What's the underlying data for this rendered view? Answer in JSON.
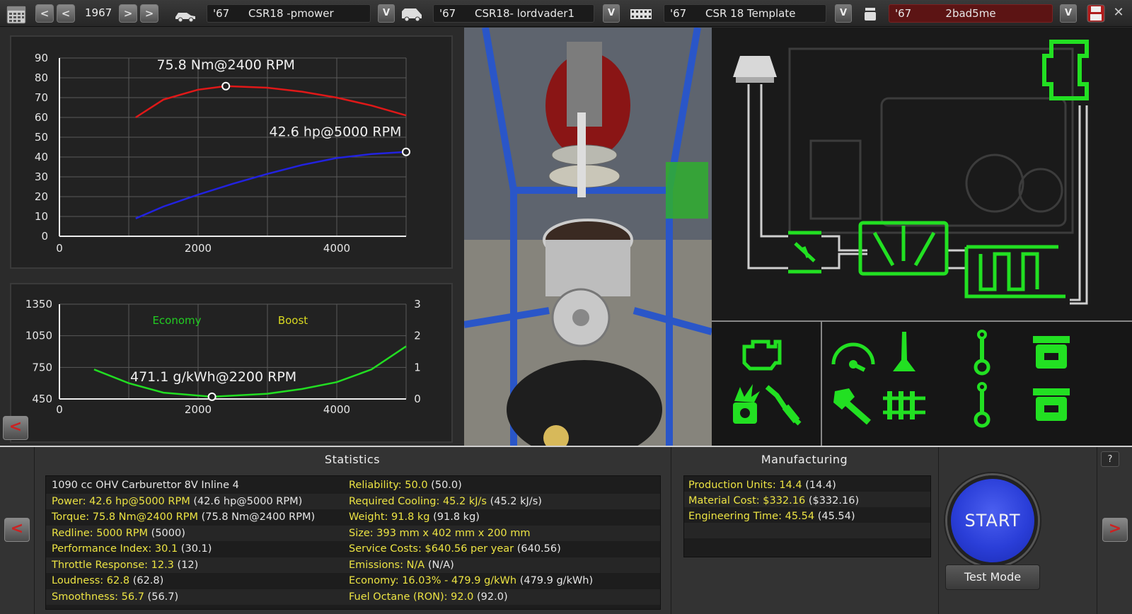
{
  "topbar": {
    "prev_fast_label": "<",
    "prev_label": "<",
    "year": "1967",
    "next_label": ">",
    "next_fast_label": ">",
    "car_field": {
      "year": "'67",
      "name": "CSR18 -pmower"
    },
    "trim_field": {
      "year": "'67",
      "name": "CSR18- lordvader1"
    },
    "chassis_field": {
      "year": "'67",
      "name": "CSR 18 Template"
    },
    "engine_field": {
      "year": "'67",
      "name": "2bad5me"
    },
    "dropdown_label": "V",
    "close_label": "✕"
  },
  "chart_data": [
    {
      "type": "line",
      "x_ticks": [
        0,
        2000,
        4000
      ],
      "y_ticks": [
        0,
        10,
        20,
        30,
        40,
        50,
        60,
        70,
        80,
        90
      ],
      "xlim": [
        0,
        5000
      ],
      "ylim": [
        0,
        90
      ],
      "grid": true,
      "series": [
        {
          "color": "#e01818",
          "x": [
            1100,
            1500,
            2000,
            2400,
            3000,
            3500,
            4000,
            4500,
            5000
          ],
          "y": [
            60,
            69,
            74,
            75.8,
            75,
            73,
            70,
            66,
            61
          ]
        },
        {
          "color": "#2222e0",
          "x": [
            1100,
            1500,
            2000,
            2500,
            3000,
            3500,
            4000,
            4500,
            5000
          ],
          "y": [
            9,
            15,
            21,
            26.5,
            31.5,
            36,
            39.5,
            41.5,
            42.6
          ]
        }
      ],
      "annotations": [
        {
          "text": "75.8 Nm@2400 RPM",
          "x": 2400,
          "y": 75.8
        },
        {
          "text": "42.6 hp@5000 RPM",
          "x": 5000,
          "y": 42.6
        }
      ]
    },
    {
      "type": "line",
      "x_ticks": [
        0,
        2000,
        4000
      ],
      "y_ticks": [
        450,
        750,
        1050,
        1350
      ],
      "y2_ticks": [
        0,
        1,
        2,
        3
      ],
      "xlim": [
        0,
        5000
      ],
      "ylim": [
        450,
        1350
      ],
      "y2lim": [
        0,
        3
      ],
      "grid": true,
      "legend": [
        {
          "name": "Economy",
          "color": "#22cc22"
        },
        {
          "name": "Boost",
          "color": "#d8d820"
        }
      ],
      "series": [
        {
          "name": "Economy",
          "color": "#22dd22",
          "x": [
            500,
            1000,
            1500,
            2200,
            3000,
            3500,
            4000,
            4500,
            5000
          ],
          "y": [
            730,
            600,
            510,
            471.1,
            500,
            545,
            610,
            730,
            950
          ]
        }
      ],
      "annotations": [
        {
          "text": "471.1 g/kWh@2200 RPM",
          "x": 2200,
          "y": 471.1
        }
      ]
    }
  ],
  "chart_nav_label": "<",
  "stats": {
    "title": "Statistics",
    "left": [
      {
        "label": "1090 cc OHV Carburettor 8V Inline 4",
        "value": ""
      },
      {
        "label": "Power: 42.6 hp@5000 RPM",
        "value": "(42.6 hp@5000 RPM)"
      },
      {
        "label": "Torque: 75.8 Nm@2400 RPM",
        "value": "(75.8 Nm@2400 RPM)"
      },
      {
        "label": "Redline: 5000 RPM",
        "value": "(5000)"
      },
      {
        "label": "Performance Index: 30.1",
        "value": "(30.1)"
      },
      {
        "label": "Throttle Response: 12.3",
        "value": "(12)"
      },
      {
        "label": "Loudness: 62.8",
        "value": "(62.8)"
      },
      {
        "label": "Smoothness: 56.7",
        "value": "(56.7)"
      }
    ],
    "right": [
      {
        "label": "Reliability: 50.0",
        "value": "(50.0)"
      },
      {
        "label": "Required Cooling: 45.2 kJ/s",
        "value": "(45.2 kJ/s)"
      },
      {
        "label": "Weight: 91.8 kg",
        "value": "(91.8 kg)"
      },
      {
        "label": "Size: 393 mm x 402 mm x 200 mm",
        "value": ""
      },
      {
        "label": "Service Costs: $640.56 per year",
        "value": "(640.56)"
      },
      {
        "label": "Emissions: N/A",
        "value": "(N/A)"
      },
      {
        "label": "Economy: 16.03% - 479.9 g/kWh",
        "value": "(479.9 g/kWh)"
      },
      {
        "label": "Fuel Octane (RON): 92.0",
        "value": "(92.0)"
      }
    ]
  },
  "manufacturing": {
    "title": "Manufacturing",
    "rows": [
      {
        "label": "Production Units: 14.4",
        "value": "(14.4)"
      },
      {
        "label": "Material Cost: $332.16",
        "value": "($332.16)"
      },
      {
        "label": "Engineering Time: 45.54",
        "value": "(45.54)"
      }
    ]
  },
  "actions": {
    "start_label": "START",
    "test_mode_label": "Test Mode",
    "help_label": "?",
    "prev_label": "<",
    "next_label": ">"
  },
  "icons": {
    "calendar": "calendar-icon",
    "car": "car-icon",
    "van": "van-icon",
    "film": "chassis-icon",
    "piston": "engine-block-icon",
    "save": "save-icon"
  },
  "colors": {
    "accent_green": "#22e022",
    "torque": "#e01818",
    "power": "#2222e0",
    "stat_label": "#ece343",
    "start_blue": "#2a3ed8"
  }
}
